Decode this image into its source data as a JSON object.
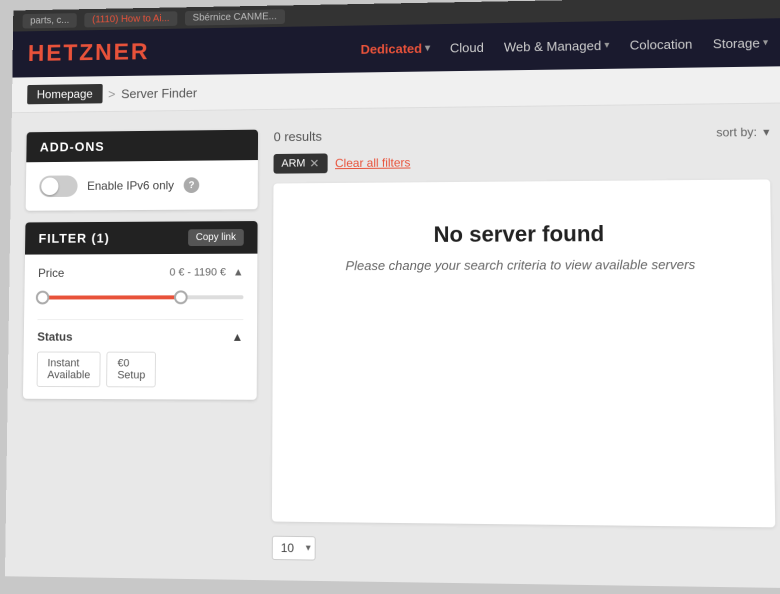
{
  "browser": {
    "tabs": [
      {
        "label": "parts, c...",
        "active": false
      },
      {
        "label": "(1110) How to Ai...",
        "icon": "▶",
        "active": false
      },
      {
        "label": "Sbérnice CANME...",
        "icon": "★",
        "active": true
      }
    ]
  },
  "nav": {
    "logo": "HETZNER",
    "links": [
      {
        "label": "Dedicated",
        "active": true,
        "has_dropdown": true
      },
      {
        "label": "Cloud",
        "active": false,
        "has_dropdown": false
      },
      {
        "label": "Web & Managed",
        "active": false,
        "has_dropdown": true
      },
      {
        "label": "Colocation",
        "active": false,
        "has_dropdown": false
      },
      {
        "label": "Storage",
        "active": false,
        "has_dropdown": true
      }
    ]
  },
  "breadcrumb": {
    "home": "Homepage",
    "separator": ">",
    "current": "Server Finder"
  },
  "addons": {
    "header": "ADD-ONS",
    "ipv6_label": "Enable IPv6 only",
    "toggle_state": "off"
  },
  "filter": {
    "header": "FILTER (1)",
    "copy_link_label": "Copy link",
    "price": {
      "label": "Price",
      "min": "0 €",
      "max": "1190 €"
    },
    "status": {
      "label": "Status",
      "options": [
        {
          "label": "Instant\nAvailable"
        },
        {
          "label": "€0\nSetup"
        }
      ]
    }
  },
  "results": {
    "count_label": "0 results",
    "sort_by_label": "sort by:",
    "active_filters": [
      {
        "tag": "ARM",
        "removable": true
      }
    ],
    "clear_all_label": "Clear all filters",
    "no_results_title": "No server found",
    "no_results_sub": "Please change your search criteria to view available servers",
    "pagination": {
      "page_size": "10",
      "chevron": "▾"
    }
  }
}
